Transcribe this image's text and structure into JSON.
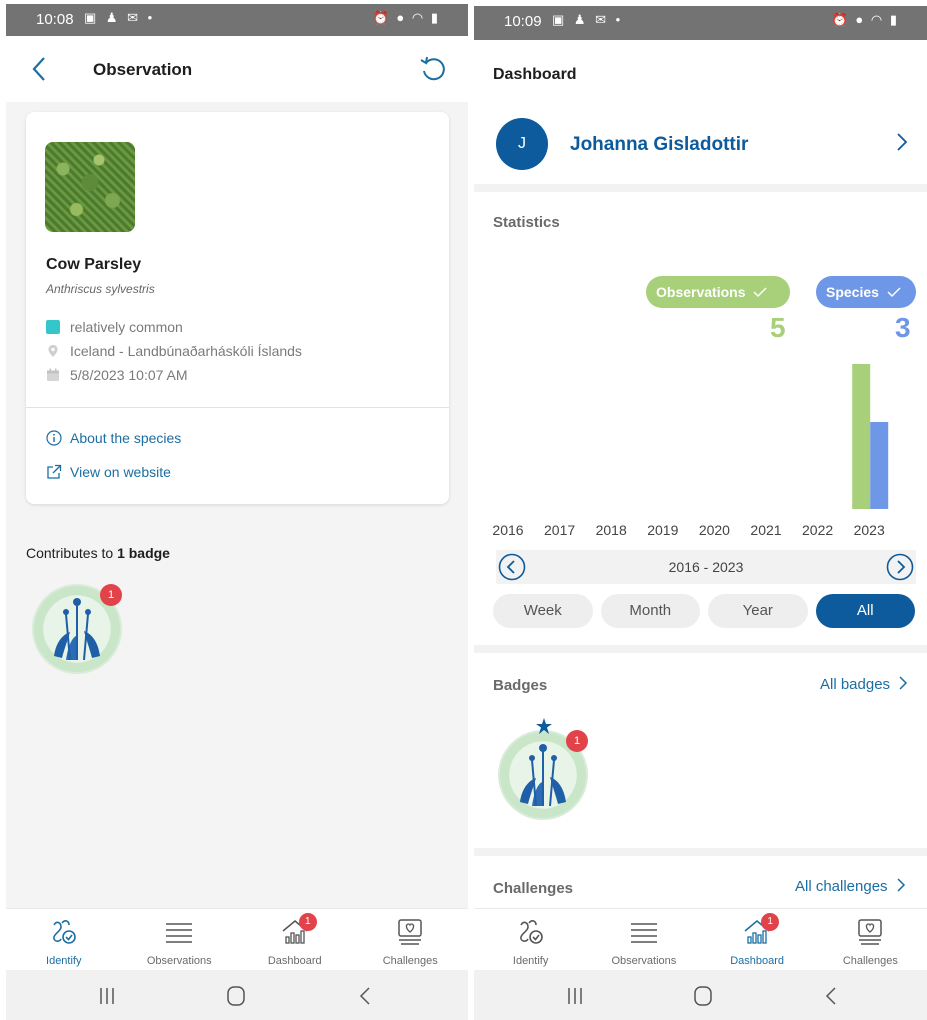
{
  "left": {
    "status_time": "10:08",
    "header": {
      "title": "Observation"
    },
    "observation": {
      "common_name": "Cow Parsley",
      "scientific_name": "Anthriscus sylvestris",
      "frequency": "relatively common",
      "location": "Iceland - Landbúnaðarháskóli Íslands",
      "datetime": "5/8/2023 10:07 AM",
      "frequency_color": "#35c6cc",
      "about_link": "About the species",
      "website_link": "View on website"
    },
    "contributes_prefix": "Contributes to",
    "contributes_count": "1 badge",
    "badge_count": "1"
  },
  "right": {
    "status_time": "10:09",
    "header": {
      "title": "Dashboard"
    },
    "user": {
      "initial": "J",
      "name": "Johanna Gisladottir"
    },
    "statistics": {
      "title": "Statistics",
      "observations_label": "Observations",
      "species_label": "Species",
      "observations_total": "5",
      "species_total": "3",
      "range_label": "2016 - 2023",
      "periods": [
        "Week",
        "Month",
        "Year",
        "All"
      ],
      "active_period": "All"
    },
    "badges": {
      "title": "Badges",
      "all_link": "All badges",
      "badge_count": "1"
    },
    "challenges": {
      "title": "Challenges",
      "all_link": "All challenges"
    }
  },
  "nav": {
    "items": [
      "Identify",
      "Observations",
      "Dashboard",
      "Challenges"
    ],
    "dashboard_badge": "1"
  },
  "colors": {
    "accent": "#1b6ea3",
    "brand_dark": "#0d5a9c",
    "observations_green": "#a8d07a",
    "species_blue": "#6f97e8",
    "notification_red": "#e2434a"
  },
  "chart_data": {
    "type": "bar",
    "categories": [
      "2016",
      "2017",
      "2018",
      "2019",
      "2020",
      "2021",
      "2022",
      "2023"
    ],
    "series": [
      {
        "name": "Observations",
        "values": [
          0,
          0,
          0,
          0,
          0,
          0,
          0,
          5
        ]
      },
      {
        "name": "Species",
        "values": [
          0,
          0,
          0,
          0,
          0,
          0,
          0,
          3
        ]
      }
    ],
    "ylim": [
      0,
      5
    ],
    "grid": false
  }
}
